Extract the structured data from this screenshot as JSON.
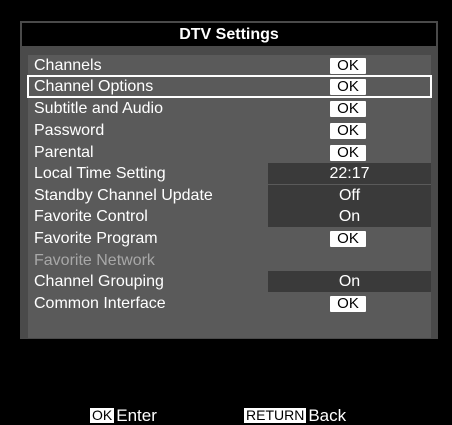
{
  "title": "DTV Settings",
  "menu": {
    "items": [
      {
        "label": "Channels",
        "ok_label": "OK"
      },
      {
        "label": "Channel Options",
        "ok_label": "OK",
        "selected": true
      },
      {
        "label": "Subtitle and Audio",
        "ok_label": "OK"
      },
      {
        "label": "Password",
        "ok_label": "OK"
      },
      {
        "label": "Parental",
        "ok_label": "OK"
      },
      {
        "label": "Local Time Setting",
        "value": "22:17"
      },
      {
        "label": "Standby Channel Update",
        "value": "Off"
      },
      {
        "label": "Favorite Control",
        "value": "On"
      },
      {
        "label": "Favorite Program",
        "ok_label": "OK"
      },
      {
        "label": "Favorite Network",
        "disabled": true
      },
      {
        "label": "Channel Grouping",
        "value": "On"
      },
      {
        "label": "Common Interface",
        "ok_label": "OK"
      }
    ]
  },
  "footer": {
    "enter_key": "OK",
    "enter_label": "Enter",
    "back_key": "RETURN",
    "back_label": "Back"
  },
  "colors": {
    "background": "#000000",
    "panel": "#4a4a4a",
    "menu": "#5a5a5a",
    "value_box": "#3a3a3a",
    "disabled_text": "#a8a8a8",
    "button": "#ffffff"
  }
}
